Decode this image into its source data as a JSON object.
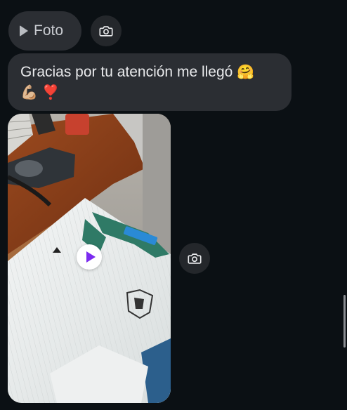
{
  "previous_message": {
    "type_label": "Foto"
  },
  "message": {
    "text": "Gracias por tu atención me llegó",
    "emoji_1": "🤗",
    "emoji_2": "💪🏼",
    "emoji_3": "❣️"
  },
  "video_message": {
    "kind": "video"
  },
  "colors": {
    "background": "#0b1014",
    "bubble": "#2b2e33",
    "play_accent": "#7b2bf0"
  }
}
